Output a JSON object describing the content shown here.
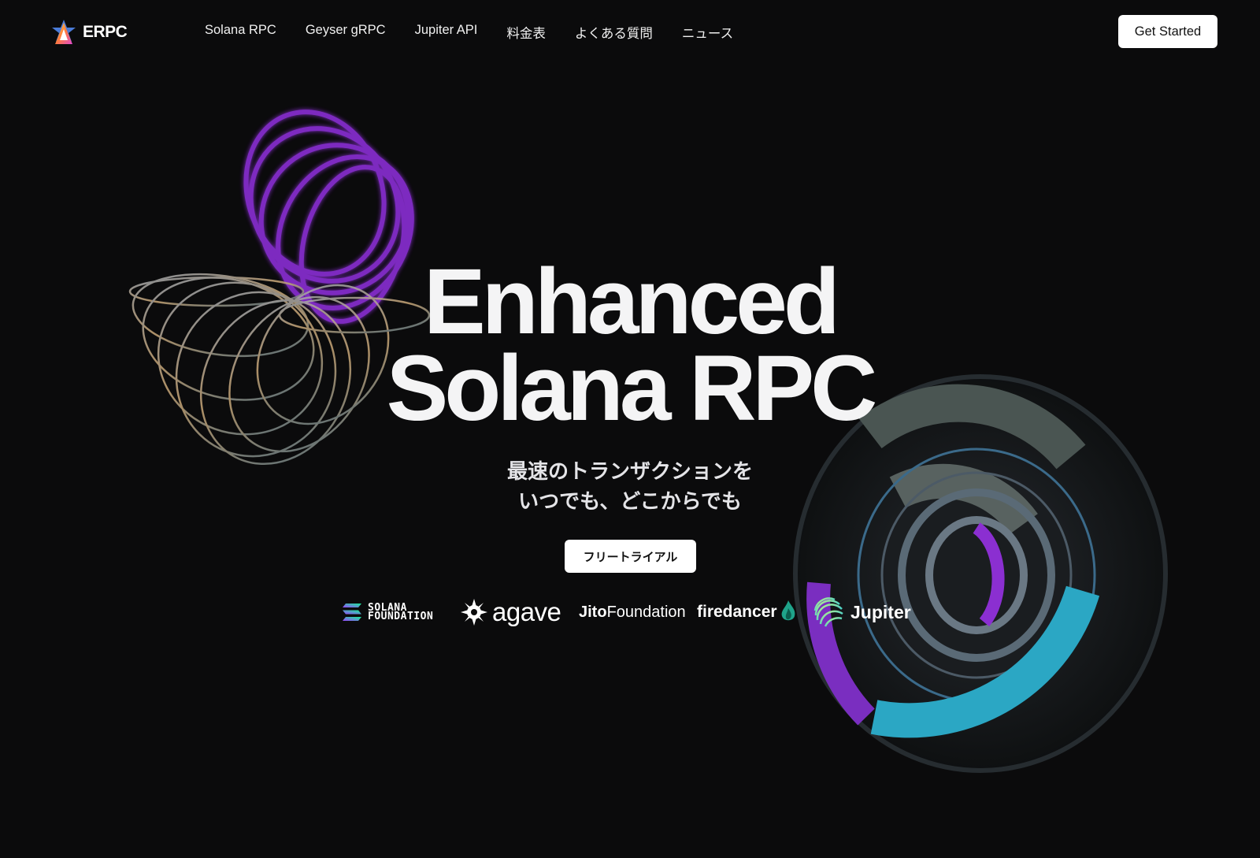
{
  "brand": {
    "name": "ERPC"
  },
  "nav": {
    "links": [
      "Solana RPC",
      "Geyser gRPC",
      "Jupiter API",
      "料金表",
      "よくある質問",
      "ニュース"
    ],
    "cta_label": "Get Started"
  },
  "hero": {
    "title_line1": "Enhanced",
    "title_line2": "Solana RPC",
    "subtitle_line1": "最速のトランザクションを",
    "subtitle_line2": "いつでも、どこからでも",
    "trial_label": "フリートライアル"
  },
  "partners": {
    "solana_line1": "SOLANA",
    "solana_line2": "FOUNDATION",
    "agave": "agave",
    "jito_a": "Jito",
    "jito_b": "Foundation",
    "firedancer": "firedancer",
    "jupiter": "Jupiter"
  },
  "colors": {
    "background": "#0b0b0c",
    "accent_purple": "#8b2fd1",
    "accent_teal": "#2ba7c4"
  }
}
